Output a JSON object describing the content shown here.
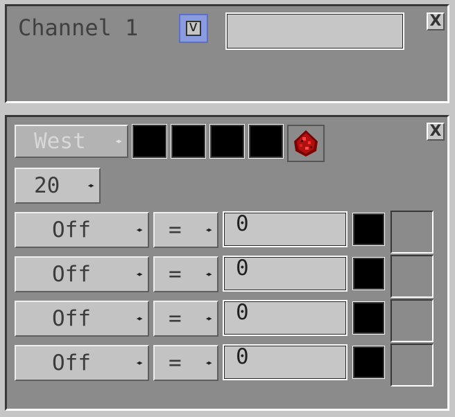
{
  "channel_panel": {
    "title": "Channel 1",
    "checkbox_mark": "v",
    "name_value": "",
    "close_label": "X"
  },
  "config_panel": {
    "close_label": "X",
    "direction": {
      "label": "West",
      "disabled": true
    },
    "color_slots": 4,
    "item_icon": "redstone-dust-icon",
    "interval": {
      "label": "20"
    },
    "arrow_glyph": "◂▸",
    "rows": [
      {
        "mode": "Off",
        "operator": "=",
        "value": "0"
      },
      {
        "mode": "Off",
        "operator": "=",
        "value": "0"
      },
      {
        "mode": "Off",
        "operator": "=",
        "value": "0"
      },
      {
        "mode": "Off",
        "operator": "=",
        "value": "0"
      }
    ]
  },
  "colors": {
    "panel": "#8b8b8b",
    "button": "#c3c3c3",
    "accent": "#7b8fd6",
    "swatch": "#000000",
    "redstone": "#b01010"
  }
}
